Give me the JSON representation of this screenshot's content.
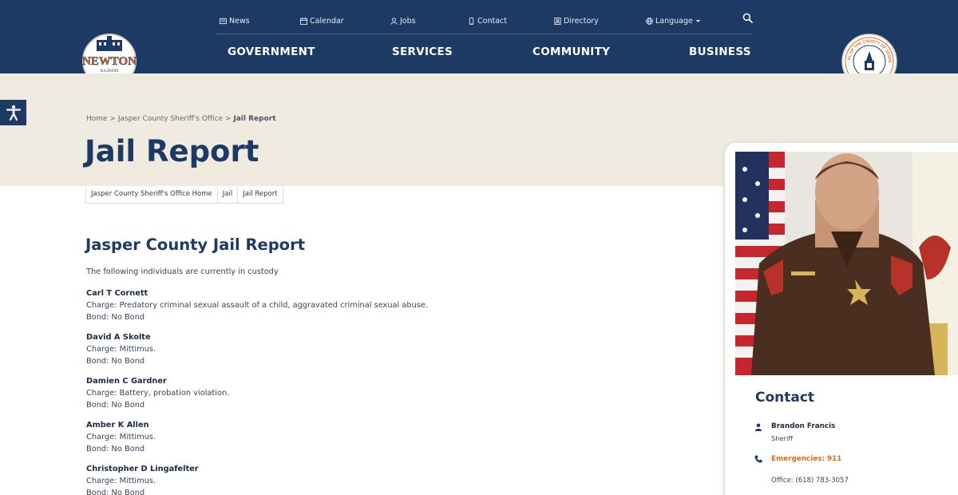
{
  "utility_nav": [
    {
      "label": "News",
      "icon": "newspaper-icon"
    },
    {
      "label": "Calendar",
      "icon": "calendar-icon"
    },
    {
      "label": "Jobs",
      "icon": "person-icon"
    },
    {
      "label": "Contact",
      "icon": "phone-icon"
    },
    {
      "label": "Directory",
      "icon": "contact-card-icon"
    },
    {
      "label": "Language",
      "icon": "globe-icon"
    }
  ],
  "main_nav": [
    "GOVERNMENT",
    "SERVICES",
    "COMMUNITY",
    "BUSINESS"
  ],
  "logo": {
    "word": "NEWTON",
    "state": "ILLINOIS",
    "county": "JASPER COUNTY"
  },
  "seal": {
    "text": "SEAL OF THE COUNTY OF JASPER",
    "state": "ILLINOIS"
  },
  "breadcrumb": {
    "home": "Home",
    "parent": "Jasper County Sheriff's Office",
    "current": "Jail Report"
  },
  "page_title": "Jail Report",
  "tabs": [
    "Jasper County Sheriff's Office Home",
    "Jail",
    "Jail Report"
  ],
  "content": {
    "title": "Jasper County Jail Report",
    "intro": "The following individuals are currently in custody",
    "inmates": [
      {
        "name": "Carl T Cornett",
        "charge": "Charge: Predatory criminal sexual assault of a child, aggravated criminal sexual abuse.",
        "bond": "Bond: No Bond"
      },
      {
        "name": "David A Skolte",
        "charge": "Charge: Mittimus.",
        "bond": "Bond: No Bond"
      },
      {
        "name": "Damien C Gardner",
        "charge": "Charge: Battery, probation violation.",
        "bond": "Bond: No Bond"
      },
      {
        "name": "Amber K Allen",
        "charge": "Charge: Mittimus.",
        "bond": "Bond: No Bond"
      },
      {
        "name": "Christopher D Lingafelter",
        "charge": "Charge: Mittimus.",
        "bond": "Bond: No Bond"
      }
    ]
  },
  "contact": {
    "title": "Contact",
    "name": "Brandon Francis",
    "role": "Sheriff",
    "emergency": "Emergencies: 911",
    "office": "Office: (618) 783-3057"
  },
  "colors": {
    "navy": "#1c3a64",
    "beige": "#efebe1",
    "orange": "#e06a1a"
  }
}
